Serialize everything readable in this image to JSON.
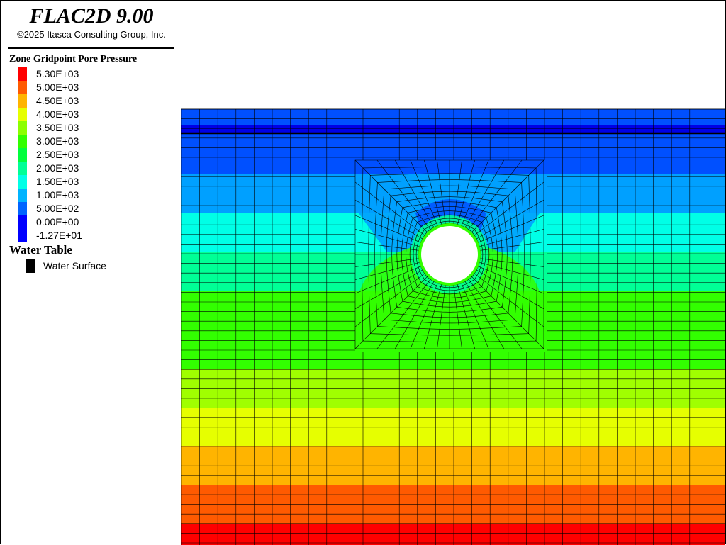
{
  "app": {
    "title": "FLAC2D 9.00",
    "copyright": "©2025 Itasca Consulting Group, Inc."
  },
  "legend": {
    "contour_title": "Zone Gridpoint Pore Pressure",
    "contour_entries": [
      {
        "label": "5.30E+03",
        "color": "#ff0000"
      },
      {
        "label": "5.00E+03",
        "color": "#ff5a00"
      },
      {
        "label": "4.50E+03",
        "color": "#ffb400"
      },
      {
        "label": "4.00E+03",
        "color": "#e6ff00"
      },
      {
        "label": "3.50E+03",
        "color": "#8cff00"
      },
      {
        "label": "3.00E+03",
        "color": "#32ff00"
      },
      {
        "label": "2.50E+03",
        "color": "#00ff3c"
      },
      {
        "label": "2.00E+03",
        "color": "#00ff96"
      },
      {
        "label": "1.50E+03",
        "color": "#00ffe6"
      },
      {
        "label": "1.00E+03",
        "color": "#00b4ff"
      },
      {
        "label": "5.00E+02",
        "color": "#0064ff"
      },
      {
        "label": "0.00E+00",
        "color": "#0000ff"
      },
      {
        "label": "-1.27E+01",
        "color": "#0000ff"
      }
    ],
    "water_table_title": "Water Table",
    "water_surface_label": "Water Surface",
    "water_surface_color": "#000000"
  },
  "chart_data": {
    "type": "heatmap",
    "title": "Zone Gridpoint Pore Pressure",
    "colorbar_ticks": [
      5300,
      5000,
      4500,
      4000,
      3500,
      3000,
      2500,
      2000,
      1500,
      1000,
      500,
      0,
      -12.7
    ],
    "colors": {
      "band_blue": "#0050ff",
      "band_dark_blue": "#0000e6",
      "band_light_blue": "#00a0ff",
      "band_cyan": "#00ffe6",
      "band_teal_green": "#00ff96",
      "band_green": "#32ff00",
      "band_yellow_green": "#a0ff00",
      "band_yellow": "#e6ff00",
      "band_orange_yellow": "#ffb400",
      "band_orange": "#ff5a00",
      "band_red": "#ff0000",
      "mesh": "#000000",
      "tunnel": "#ffffff"
    },
    "mesh": "structured quadrilateral grid with radial refinement around a circular tunnel",
    "water_surface": "horizontal line near the top of the model",
    "grid": true
  }
}
